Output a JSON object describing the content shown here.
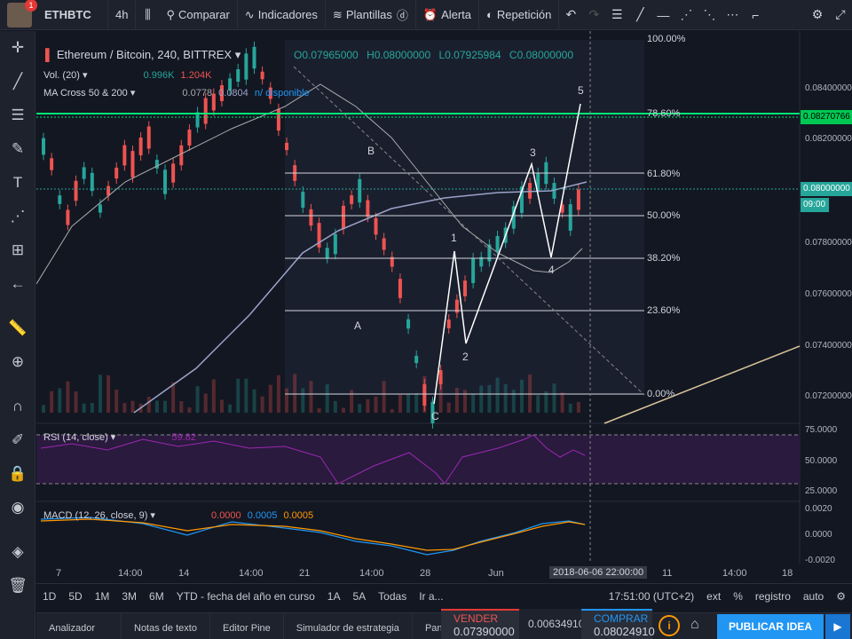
{
  "top_toolbar": {
    "notification_count": "1",
    "symbol": "ETHBTC",
    "interval": "4h",
    "compare": "Comparar",
    "indicators": "Indicadores",
    "templates": "Plantillas",
    "alert": "Alerta",
    "replay": "Repetición"
  },
  "chart": {
    "title": "Ethereum / Bitcoin, 240, BITTREX",
    "ohlc": {
      "o": "O0.07965000",
      "h": "H0.08000000",
      "l": "L0.07925984",
      "c": "C0.08000000"
    },
    "vol_label": "Vol. (20)",
    "vol_vals": [
      "0.996K",
      "1.204K"
    ],
    "ma_label": "MA Cross 50 & 200",
    "ma_vals": [
      "0.0778",
      "0.0804",
      "n/ disponible"
    ],
    "rsi_label": "RSI (14, close)",
    "rsi_val": "59.82",
    "macd_label": "MACD (12, 26, close, 9)",
    "macd_vals": [
      "0.0000",
      "0.0005",
      "0.0005"
    ],
    "price_axis": [
      "0.08400000",
      "0.08200000",
      "0.07800000",
      "0.07600000",
      "0.07400000",
      "0.07200000"
    ],
    "price_tag_current": "0.08270766",
    "price_tag_last": "0.08000000",
    "time_tag": "09:00",
    "rsi_axis": [
      "75.0000",
      "50.0000",
      "25.0000"
    ],
    "macd_axis": [
      "0.0020",
      "0.0000",
      "-0.0020"
    ],
    "time_axis": [
      "7",
      "14:00",
      "14",
      "14:00",
      "21",
      "14:00",
      "28",
      "Jun",
      "11",
      "14:00",
      "18"
    ],
    "time_cursor": "2018-06-06 22:00:00",
    "fib_levels": [
      "100.00%",
      "78.60%",
      "61.80%",
      "50.00%",
      "38.20%",
      "23.60%",
      "0.00%"
    ],
    "wave_labels": [
      "A",
      "B",
      "C",
      "1",
      "2",
      "3",
      "4",
      "5"
    ]
  },
  "range_bar": {
    "ranges": [
      "1D",
      "5D",
      "1M",
      "3M",
      "6M",
      "YTD - fecha del año en curso",
      "1A",
      "5A",
      "Todas",
      "Ir a..."
    ],
    "clock": "17:51:00 (UTC+2)",
    "options": [
      "ext",
      "%",
      "registro",
      "auto"
    ]
  },
  "bottom_tabs": [
    "Analizador",
    "Notas de texto",
    "Editor Pine",
    "Simulador de estrategia",
    "Panel de trading"
  ],
  "trade": {
    "sell_label": "VENDER",
    "sell_price": "0.07390000",
    "spread": "0.00634910",
    "buy_label": "COMPRAR",
    "buy_price": "0.08024910",
    "publish": "PUBLICAR IDEA"
  },
  "colors": {
    "bull": "#26a69a",
    "bear": "#ef5350",
    "fib_line": "#d1d4dc",
    "resistance": "#00e676",
    "rsi": "#9c27b0",
    "macd": "#2196f3",
    "signal": "#ff9800"
  }
}
